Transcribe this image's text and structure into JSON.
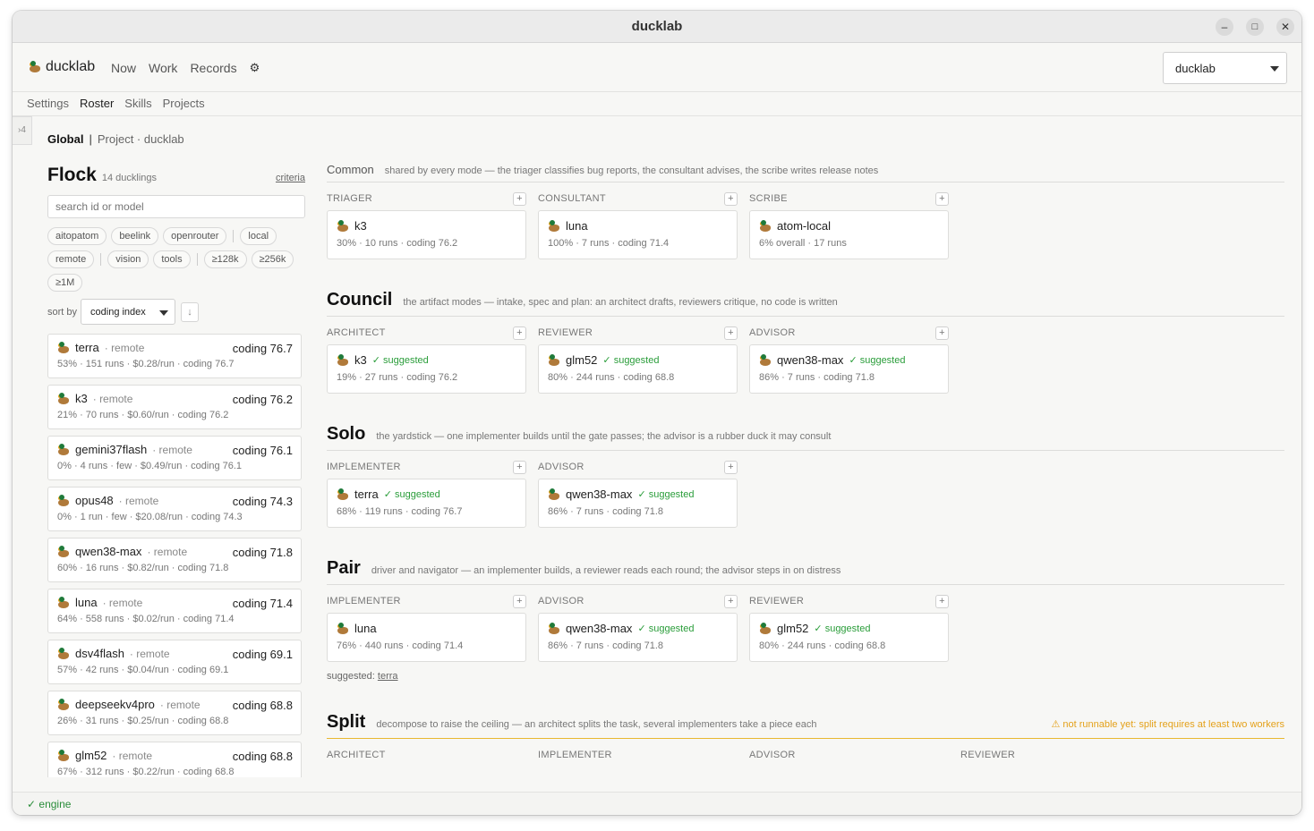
{
  "window": {
    "title": "ducklab",
    "min": "–",
    "max": "□",
    "close": "✕"
  },
  "topnav": {
    "brand": "ducklab",
    "links": [
      "Now",
      "Work",
      "Records"
    ],
    "gear": "⚙",
    "project_select": "ducklab"
  },
  "subnav": [
    "Settings",
    "Roster",
    "Skills",
    "Projects"
  ],
  "side_toggle": "›4",
  "scope": {
    "global": "Global",
    "sep": "|",
    "project": "Project · ducklab"
  },
  "flock": {
    "title": "Flock",
    "count": "14 ducklings",
    "criteria": "criteria",
    "search_placeholder": "search id or model",
    "chips_row": [
      "aitopatom",
      "beelink",
      "openrouter",
      "local",
      "remote",
      "vision",
      "tools",
      "≥128k",
      "≥256k",
      "≥1M"
    ],
    "sort_label": "sort by",
    "sort_value": "coding index",
    "sort_dir": "↓",
    "ducks": [
      {
        "name": "terra",
        "loc": "· remote",
        "score": "coding 76.7",
        "stats": "53% · 151 runs · $0.28/run · coding 76.7"
      },
      {
        "name": "k3",
        "loc": "· remote",
        "score": "coding 76.2",
        "stats": "21% · 70 runs · $0.60/run · coding 76.2"
      },
      {
        "name": "gemini37flash",
        "loc": "· remote",
        "score": "coding 76.1",
        "stats": "0% · 4 runs · few · $0.49/run · coding 76.1"
      },
      {
        "name": "opus48",
        "loc": "· remote",
        "score": "coding 74.3",
        "stats": "0% · 1 run · few · $20.08/run · coding 74.3"
      },
      {
        "name": "qwen38-max",
        "loc": "· remote",
        "score": "coding 71.8",
        "stats": "60% · 16 runs · $0.82/run · coding 71.8"
      },
      {
        "name": "luna",
        "loc": "· remote",
        "score": "coding 71.4",
        "stats": "64% · 558 runs · $0.02/run · coding 71.4"
      },
      {
        "name": "dsv4flash",
        "loc": "· remote",
        "score": "coding 69.1",
        "stats": "57% · 42 runs · $0.04/run · coding 69.1"
      },
      {
        "name": "deepseekv4pro",
        "loc": "· remote",
        "score": "coding 68.8",
        "stats": "26% · 31 runs · $0.25/run · coding 68.8"
      },
      {
        "name": "glm52",
        "loc": "· remote",
        "score": "coding 68.8",
        "stats": "67% · 312 runs · $0.22/run · coding 68.8"
      }
    ]
  },
  "modes": {
    "common": {
      "name": "Common",
      "desc": "shared by every mode — the triager classifies bug reports, the consultant advises, the scribe writes release notes",
      "roles": [
        {
          "label": "TRIAGER",
          "duck": "k3",
          "suggested": "",
          "stats": "30% · 10 runs · coding 76.2"
        },
        {
          "label": "CONSULTANT",
          "duck": "luna",
          "suggested": "",
          "stats": "100% · 7 runs · coding 71.4"
        },
        {
          "label": "SCRIBE",
          "duck": "atom-local",
          "suggested": "",
          "stats": "6% overall · 17 runs"
        }
      ]
    },
    "council": {
      "name": "Council",
      "desc": "the artifact modes — intake, spec and plan: an architect drafts, reviewers critique, no code is written",
      "roles": [
        {
          "label": "ARCHITECT",
          "duck": "k3",
          "suggested": "✓ suggested",
          "stats": "19% · 27 runs · coding 76.2"
        },
        {
          "label": "REVIEWER",
          "duck": "glm52",
          "suggested": "✓ suggested",
          "stats": "80% · 244 runs · coding 68.8"
        },
        {
          "label": "ADVISOR",
          "duck": "qwen38-max",
          "suggested": "✓ suggested",
          "stats": "86% · 7 runs · coding 71.8"
        }
      ]
    },
    "solo": {
      "name": "Solo",
      "desc": "the yardstick — one implementer builds until the gate passes; the advisor is a rubber duck it may consult",
      "roles": [
        {
          "label": "IMPLEMENTER",
          "duck": "terra",
          "suggested": "✓ suggested",
          "stats": "68% · 119 runs · coding 76.7"
        },
        {
          "label": "ADVISOR",
          "duck": "qwen38-max",
          "suggested": "✓ suggested",
          "stats": "86% · 7 runs · coding 71.8"
        }
      ]
    },
    "pair": {
      "name": "Pair",
      "desc": "driver and navigator — an implementer builds, a reviewer reads each round; the advisor steps in on distress",
      "roles": [
        {
          "label": "IMPLEMENTER",
          "duck": "luna",
          "suggested": "",
          "stats": "76% · 440 runs · coding 71.4"
        },
        {
          "label": "ADVISOR",
          "duck": "qwen38-max",
          "suggested": "✓ suggested",
          "stats": "86% · 7 runs · coding 71.8"
        },
        {
          "label": "REVIEWER",
          "duck": "glm52",
          "suggested": "✓ suggested",
          "stats": "80% · 244 runs · coding 68.8"
        }
      ],
      "suggested_label": "suggested:",
      "suggested_name": "terra"
    },
    "split": {
      "name": "Split",
      "desc": "decompose to raise the ceiling — an architect splits the task, several implementers take a piece each",
      "warning": "⚠ not runnable yet: split requires at least two workers",
      "roles": [
        "ARCHITECT",
        "IMPLEMENTER",
        "ADVISOR",
        "REVIEWER"
      ]
    }
  },
  "add_label": "+",
  "status": "✓ engine",
  "colors": {
    "accent_green": "#2a9d3a",
    "warning": "#e4a11a"
  }
}
